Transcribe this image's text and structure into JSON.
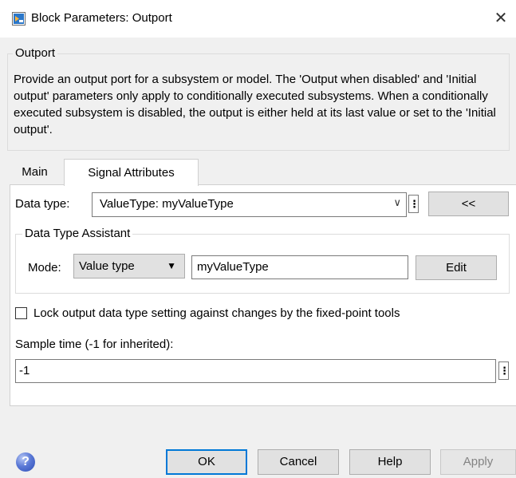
{
  "window": {
    "title": "Block Parameters: Outport",
    "close_glyph": "✕"
  },
  "block_group": {
    "label": "Outport",
    "description": "Provide an output port for a subsystem or model.  The 'Output when disabled' and 'Initial output' parameters only apply to conditionally executed subsystems. When a conditionally executed subsystem is disabled, the output is either held at its last value or set to the 'Initial output'."
  },
  "tabs": [
    {
      "label": "Main",
      "active": false
    },
    {
      "label": "Signal Attributes",
      "active": true
    }
  ],
  "data_type": {
    "label": "Data type:",
    "value": "ValueType: myValueType",
    "dropdown_glyph": "∨",
    "menu_glyph": "⋮",
    "assistant_toggle_label": "<<"
  },
  "assistant": {
    "label": "Data Type Assistant",
    "mode_label": "Mode:",
    "mode_value": "Value type",
    "mode_dropdown_glyph": "▼",
    "type_value": "myValueType",
    "edit_label": "Edit"
  },
  "lock_option": {
    "label": "Lock output data type setting against changes by the fixed-point tools",
    "checked": false
  },
  "sample_time": {
    "label": "Sample time (-1 for inherited):",
    "value": "-1",
    "menu_glyph": "⋮"
  },
  "footer": {
    "help_glyph": "?",
    "ok_label": "OK",
    "cancel_label": "Cancel",
    "help_label": "Help",
    "apply_label": "Apply"
  },
  "icons": {
    "app_icon": "simulink-block-icon",
    "help_icon": "question-circle-icon"
  },
  "colors": {
    "accent": "#0078d7",
    "window_bg": "#f0f0f0",
    "panel_bg": "#ffffff",
    "disabled_text": "#838383"
  }
}
